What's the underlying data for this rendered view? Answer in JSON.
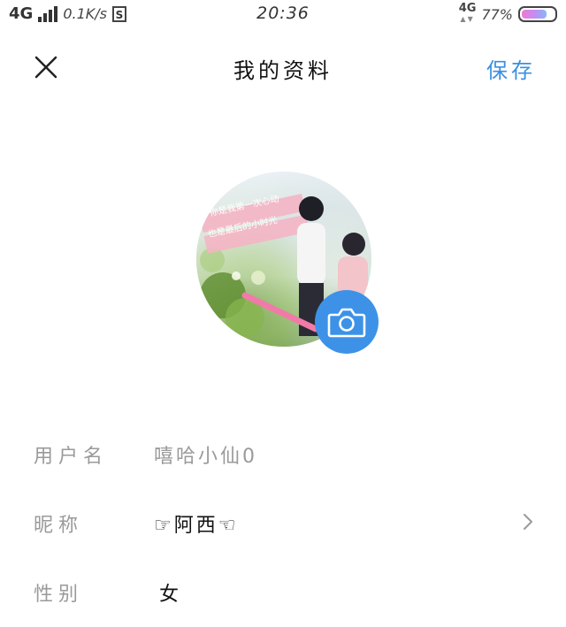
{
  "status_bar": {
    "network": "4G",
    "speed": "0.1K/s",
    "sim_badge": "S",
    "time": "20:36",
    "network_right": "4G",
    "battery_percent": "77%",
    "battery_level": 0.77,
    "icons": [
      "signal-icon",
      "sim-icon",
      "battery-icon"
    ]
  },
  "header": {
    "title": "我的资料",
    "save_label": "保存",
    "close_icon": "close-icon"
  },
  "avatar": {
    "image_text_line1": "你是我第一次心动",
    "image_text_line2": "也是最后的小时光",
    "camera_icon": "camera-icon",
    "camera_color": "#3d92e8"
  },
  "form": {
    "username": {
      "label": "用户名",
      "value": "嘻哈小仙0"
    },
    "nickname": {
      "label": "昵称",
      "value": "☞阿西☜",
      "chevron_icon": "chevron-right-icon"
    },
    "gender": {
      "label": "性别",
      "value": "女"
    }
  },
  "colors": {
    "accent": "#3b8fe0",
    "label_gray": "#9a9a9a",
    "text_dark": "#111111"
  }
}
